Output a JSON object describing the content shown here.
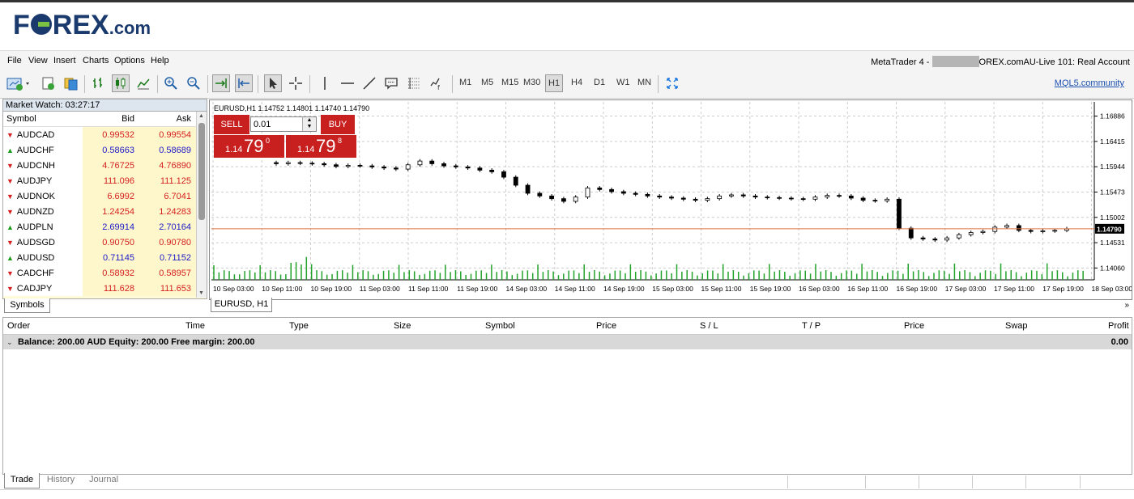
{
  "logo": {
    "brand": "FOREX",
    "suffix": ".com"
  },
  "menu": {
    "items": [
      "File",
      "View",
      "Insert",
      "Charts",
      "Options",
      "Help"
    ],
    "title_prefix": "MetaTrader 4 - ",
    "title_suffix": "OREX.comAU-Live 101: Real Account"
  },
  "toolbar": {
    "timeframes": [
      "M1",
      "M5",
      "M15",
      "M30",
      "H1",
      "H4",
      "D1",
      "W1",
      "MN"
    ],
    "active_timeframe": "H1",
    "mql_link": "MQL5.community"
  },
  "market_watch": {
    "title": "Market Watch: 03:27:17",
    "columns": {
      "symbol": "Symbol",
      "bid": "Bid",
      "ask": "Ask"
    },
    "rows": [
      {
        "symbol": "AUDCAD",
        "dir": "down",
        "bid": "0.99532",
        "ask": "0.99554",
        "bid_color": "red",
        "ask_color": "red"
      },
      {
        "symbol": "AUDCHF",
        "dir": "up",
        "bid": "0.58663",
        "ask": "0.58689",
        "bid_color": "blue",
        "ask_color": "blue"
      },
      {
        "symbol": "AUDCNH",
        "dir": "down",
        "bid": "4.76725",
        "ask": "4.76890",
        "bid_color": "red",
        "ask_color": "red"
      },
      {
        "symbol": "AUDJPY",
        "dir": "down",
        "bid": "111.096",
        "ask": "111.125",
        "bid_color": "red",
        "ask_color": "red"
      },
      {
        "symbol": "AUDNOK",
        "dir": "down",
        "bid": "6.6992",
        "ask": "6.7041",
        "bid_color": "red",
        "ask_color": "red"
      },
      {
        "symbol": "AUDNZD",
        "dir": "down",
        "bid": "1.24254",
        "ask": "1.24283",
        "bid_color": "red",
        "ask_color": "red"
      },
      {
        "symbol": "AUDPLN",
        "dir": "up",
        "bid": "2.69914",
        "ask": "2.70164",
        "bid_color": "blue",
        "ask_color": "blue"
      },
      {
        "symbol": "AUDSGD",
        "dir": "down",
        "bid": "0.90750",
        "ask": "0.90780",
        "bid_color": "red",
        "ask_color": "red"
      },
      {
        "symbol": "AUDUSD",
        "dir": "up",
        "bid": "0.71145",
        "ask": "0.71152",
        "bid_color": "blue",
        "ask_color": "blue"
      },
      {
        "symbol": "CADCHF",
        "dir": "down",
        "bid": "0.58932",
        "ask": "0.58957",
        "bid_color": "red",
        "ask_color": "red"
      },
      {
        "symbol": "CADJPY",
        "dir": "down",
        "bid": "111.628",
        "ask": "111.653",
        "bid_color": "red",
        "ask_color": "red"
      }
    ],
    "tab": "Symbols"
  },
  "chart": {
    "header": "EURUSD,H1  1.14752 1.14801 1.14740 1.14790",
    "tab": "EURUSD, H1",
    "one_click": {
      "sell_label": "SELL",
      "buy_label": "BUY",
      "lot": "0.01",
      "sell_small": "1.14",
      "sell_big": "79",
      "sell_sup": "0",
      "buy_small": "1.14",
      "buy_big": "79",
      "buy_sup": "8"
    },
    "current_price": "1.14790"
  },
  "chart_data": {
    "type": "line",
    "title": "",
    "y_ticks": [
      "1.16886",
      "1.16415",
      "1.15944",
      "1.15473",
      "1.15002",
      "1.14531",
      "1.14060"
    ],
    "x_ticks": [
      "10 Sep 03:00",
      "10 Sep 11:00",
      "10 Sep 19:00",
      "11 Sep 03:00",
      "11 Sep 11:00",
      "11 Sep 19:00",
      "14 Sep 03:00",
      "14 Sep 11:00",
      "14 Sep 19:00",
      "15 Sep 03:00",
      "15 Sep 11:00",
      "15 Sep 19:00",
      "16 Sep 03:00",
      "16 Sep 11:00",
      "16 Sep 19:00",
      "17 Sep 03:00",
      "17 Sep 11:00",
      "17 Sep 19:00",
      "18 Sep 03:00"
    ],
    "ylim": [
      1.1384,
      1.1715
    ],
    "close": [
      1.16,
      1.1602,
      1.1601,
      1.16,
      1.1598,
      1.1595,
      1.1597,
      1.1596,
      1.1594,
      1.1592,
      1.159,
      1.1598,
      1.1605,
      1.16,
      1.1596,
      1.1594,
      1.1592,
      1.1588,
      1.1585,
      1.1575,
      1.156,
      1.1545,
      1.154,
      1.1535,
      1.153,
      1.1538,
      1.1555,
      1.1552,
      1.1548,
      1.1545,
      1.1543,
      1.154,
      1.1538,
      1.1536,
      1.1534,
      1.1532,
      1.1535,
      1.154,
      1.1542,
      1.154,
      1.1538,
      1.1537,
      1.1536,
      1.1535,
      1.1534,
      1.1538,
      1.1541,
      1.154,
      1.1536,
      1.1532,
      1.1531,
      1.1534,
      1.148,
      1.1462,
      1.146,
      1.1458,
      1.1462,
      1.1468,
      1.1472,
      1.1474,
      1.1482,
      1.1485,
      1.1476,
      1.1474,
      1.1475,
      1.1476,
      1.1479
    ]
  },
  "terminal": {
    "columns": [
      "Order",
      "Time",
      "Type",
      "Size",
      "Symbol",
      "Price",
      "S / L",
      "T / P",
      "Price",
      "Swap",
      "Profit"
    ],
    "balance_line": "Balance: 200.00 AUD  Equity: 200.00  Free margin: 200.00",
    "profit_total": "0.00",
    "tabs": [
      "Trade",
      "History",
      "Journal"
    ],
    "active_tab": "Trade"
  }
}
